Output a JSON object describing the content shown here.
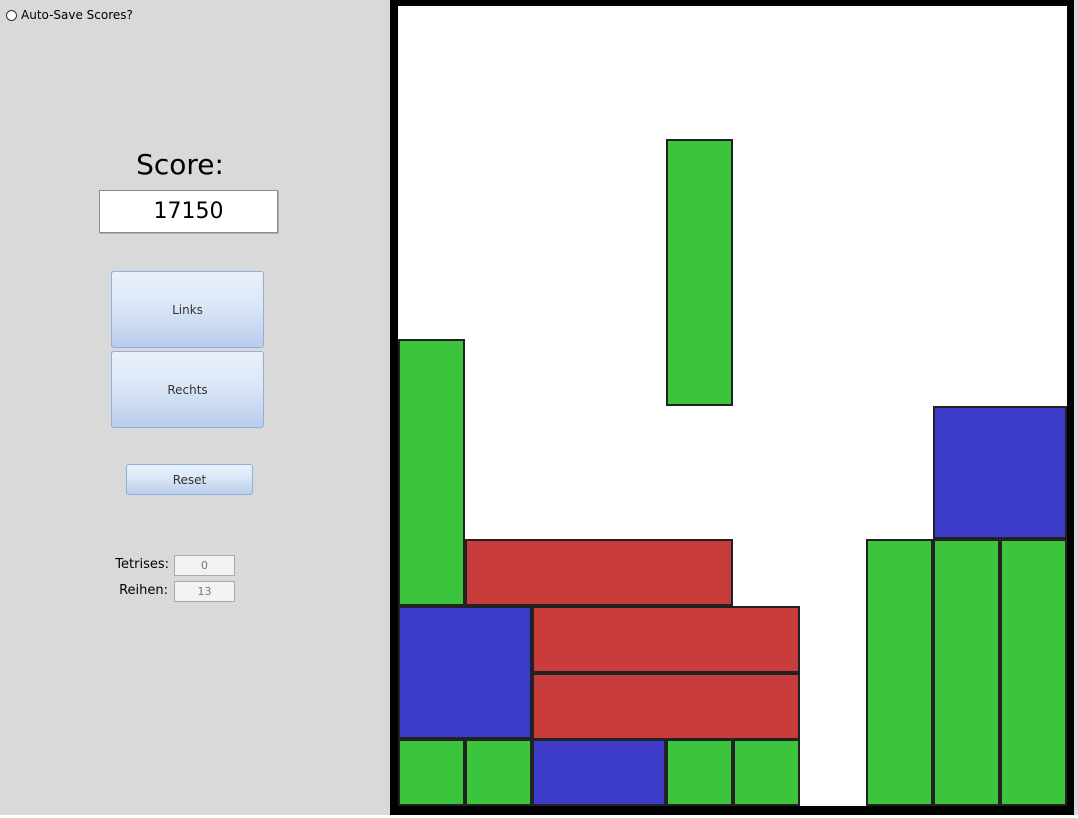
{
  "autosave": {
    "label": "Auto-Save Scores?",
    "checked": false
  },
  "score": {
    "label": "Score:",
    "value": "17150"
  },
  "controls": {
    "left_label": "Links",
    "right_label": "Rechts",
    "reset_label": "Reset"
  },
  "stats": {
    "tetrises_label": "Tetrises:",
    "tetrises_value": "0",
    "rows_label": "Reihen:",
    "rows_value": "13"
  },
  "colors": {
    "green": "#3cc43c",
    "red": "#c83c3c",
    "blue": "#3c3cc8",
    "board_bg": "#ffffff",
    "frame": "#000000"
  },
  "board": {
    "columns": 10,
    "rows": 12,
    "pieces": [
      {
        "name": "falling-piece-green",
        "color": "green",
        "col": 4,
        "row": 2,
        "w": 1,
        "h": 4
      },
      {
        "name": "piece-green-left-tall",
        "color": "green",
        "col": 0,
        "row": 5,
        "w": 1,
        "h": 4
      },
      {
        "name": "piece-red-top",
        "color": "red",
        "col": 1,
        "row": 8,
        "w": 4,
        "h": 1
      },
      {
        "name": "piece-blue-left",
        "color": "blue",
        "col": 0,
        "row": 9,
        "w": 2,
        "h": 2
      },
      {
        "name": "piece-red-mid",
        "color": "red",
        "col": 2,
        "row": 9,
        "w": 4,
        "h": 1
      },
      {
        "name": "piece-red-low",
        "color": "red",
        "col": 2,
        "row": 10,
        "w": 4,
        "h": 1
      },
      {
        "name": "cell-green-bottom-0",
        "color": "green",
        "col": 0,
        "row": 11,
        "w": 1,
        "h": 1
      },
      {
        "name": "cell-green-bottom-1",
        "color": "green",
        "col": 1,
        "row": 11,
        "w": 1,
        "h": 1
      },
      {
        "name": "piece-blue-bottom",
        "color": "blue",
        "col": 2,
        "row": 11,
        "w": 2,
        "h": 1
      },
      {
        "name": "cell-green-bottom-4",
        "color": "green",
        "col": 4,
        "row": 11,
        "w": 1,
        "h": 1
      },
      {
        "name": "cell-green-bottom-5",
        "color": "green",
        "col": 5,
        "row": 11,
        "w": 1,
        "h": 1
      },
      {
        "name": "piece-blue-right",
        "color": "blue",
        "col": 8,
        "row": 6,
        "w": 2,
        "h": 2
      },
      {
        "name": "piece-green-right-col7",
        "color": "green",
        "col": 7,
        "row": 8,
        "w": 1,
        "h": 4
      },
      {
        "name": "piece-green-right-col8",
        "color": "green",
        "col": 8,
        "row": 8,
        "w": 1,
        "h": 4
      },
      {
        "name": "piece-green-right-col9",
        "color": "green",
        "col": 9,
        "row": 8,
        "w": 1,
        "h": 4
      }
    ]
  }
}
